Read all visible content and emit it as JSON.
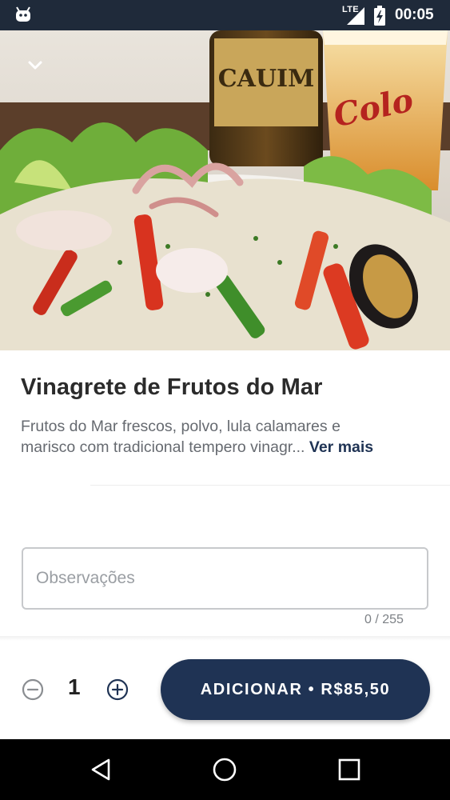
{
  "status_bar": {
    "network": "LTE",
    "time": "00:05",
    "icons": [
      "android-icon",
      "signal-icon",
      "battery-icon"
    ]
  },
  "hero": {
    "collapse_icon": "chevron-down-icon",
    "bottle_label": "CAUIM",
    "glass_label": "Colo"
  },
  "product": {
    "title": "Vinagrete de Frutos do Mar",
    "description_line1": "Frutos do Mar frescos, polvo, lula calamares e",
    "description_line2": "marisco com tradicional tempero vinagr...",
    "see_more": "Ver mais"
  },
  "notes": {
    "placeholder": "Observações",
    "value": "",
    "counter": "0 / 255"
  },
  "order": {
    "quantity": "1",
    "add_label": "ADICIONAR • R$85,50"
  },
  "colors": {
    "primary": "#1f3354",
    "status_bar": "#1f2a3a",
    "text_dark": "#2b2b2b",
    "text_muted": "#666a70"
  },
  "nav": {
    "icons": [
      "back-icon",
      "home-icon",
      "recents-icon"
    ]
  }
}
